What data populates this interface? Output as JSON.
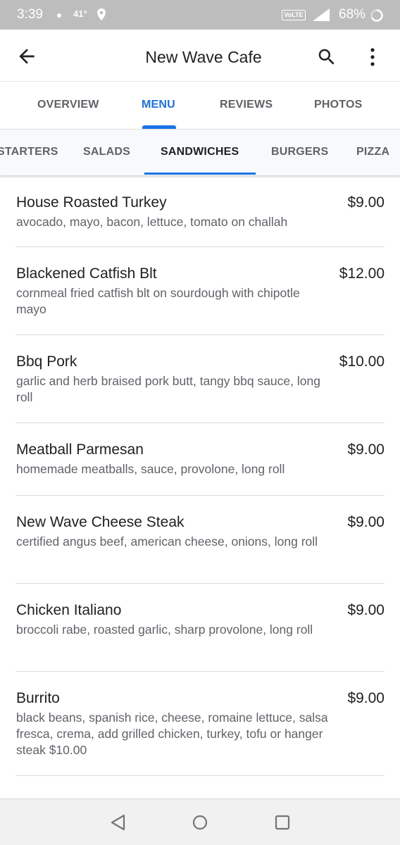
{
  "status_bar": {
    "time": "3:39",
    "temperature": "41°",
    "network_badge": "VoLTE",
    "battery": "68%",
    "icons": [
      "notification-dot-icon",
      "location-pin-icon",
      "signal-icon",
      "battery-ring-icon"
    ]
  },
  "app_bar": {
    "title": "New Wave Cafe",
    "icons": [
      "back-arrow-icon",
      "search-icon",
      "more-vert-icon"
    ]
  },
  "tabs": {
    "active": "MENU",
    "items": [
      "OVERVIEW",
      "MENU",
      "REVIEWS",
      "PHOTOS"
    ]
  },
  "categories": {
    "active": "SANDWICHES",
    "items": [
      "STARTERS",
      "SALADS",
      "SANDWICHES",
      "BURGERS",
      "PIZZA"
    ]
  },
  "menu_items": [
    {
      "name": "House Roasted Turkey",
      "price": "$9.00",
      "description": "avocado, mayo, bacon, lettuce, tomato on challah"
    },
    {
      "name": "Blackened Catfish Blt",
      "price": "$12.00",
      "description": "cornmeal fried catfish blt on sourdough with chipotle mayo"
    },
    {
      "name": "Bbq Pork",
      "price": "$10.00",
      "description": "garlic and herb braised pork butt, tangy bbq sauce, long roll"
    },
    {
      "name": "Meatball Parmesan",
      "price": "$9.00",
      "description": "homemade meatballs, sauce, provolone, long roll"
    },
    {
      "name": "New Wave Cheese Steak",
      "price": "$9.00",
      "description": "certified angus beef, american cheese, onions, long roll"
    },
    {
      "name": "Chicken Italiano",
      "price": "$9.00",
      "description": "broccoli rabe, roasted garlic, sharp provolone, long roll"
    },
    {
      "name": "Burrito",
      "price": "$9.00",
      "description": "black beans, spanish rice, cheese, romaine lettuce, salsa fresca, crema, add grilled chicken, turkey, tofu or hanger steak $10.00"
    }
  ],
  "nav_bar": {
    "icons": [
      "nav-back-icon",
      "nav-home-icon",
      "nav-recents-icon"
    ]
  },
  "colors": {
    "accent": "#1a73e8",
    "status_bar": "#bdbdbd",
    "primary_text": "#202124",
    "secondary_text": "#5f6368"
  }
}
